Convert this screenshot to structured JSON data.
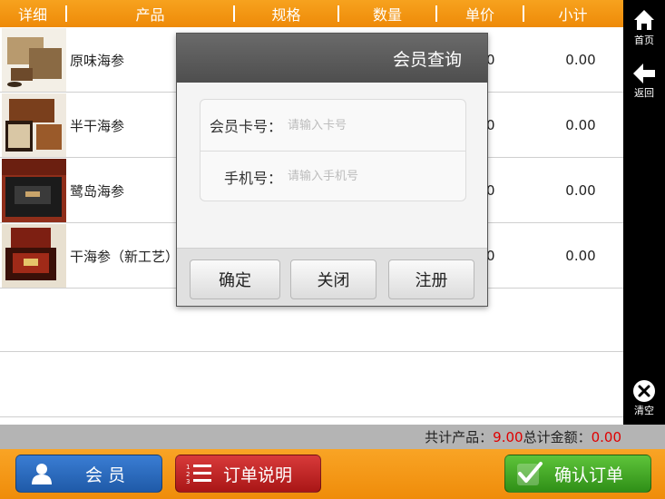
{
  "header": {
    "columns": [
      "详细",
      "产品",
      "规格",
      "数量",
      "单价",
      "小计"
    ]
  },
  "sidebar": {
    "home_label": "首页",
    "back_label": "返回",
    "clear_label": "清空"
  },
  "products": [
    {
      "name": "原味海参",
      "subtotal": "0.00",
      "price_fragment": "0",
      "thumb_colors": [
        "#b89a6e",
        "#6d4a2b",
        "#f3efe6"
      ]
    },
    {
      "name": "半干海参",
      "subtotal": "0.00",
      "price_fragment": "0",
      "thumb_colors": [
        "#7a3f1c",
        "#d9c7a5",
        "#2b1a10"
      ]
    },
    {
      "name": "鹭岛海参",
      "subtotal": "0.00",
      "price_fragment": "0",
      "thumb_colors": [
        "#8f2e1a",
        "#1b1b1b",
        "#c9a46a"
      ]
    },
    {
      "name": "干海参（新工艺）",
      "subtotal": "0.00",
      "price_fragment": "0",
      "thumb_colors": [
        "#7d1f12",
        "#e8e0d0",
        "#3a1008"
      ]
    }
  ],
  "totals": {
    "count_label": "共计产品：",
    "count_value": "9.00",
    "amount_label": "总计金额：",
    "amount_value": "0.00"
  },
  "footer": {
    "member_label": "会 员",
    "notes_label": "订单说明",
    "confirm_label": "确认订单"
  },
  "modal": {
    "title": "会员查询",
    "card_label": "会员卡号：",
    "card_placeholder": "请输入卡号",
    "phone_label": "手机号：",
    "phone_placeholder": "请输入手机号",
    "ok_label": "确定",
    "close_label": "关闭",
    "register_label": "注册"
  },
  "colors": {
    "accent_orange": "#f39a16",
    "member_blue": "#2a6cc0",
    "notes_red": "#c02424",
    "confirm_green": "#44a824",
    "total_red": "#e00000"
  }
}
